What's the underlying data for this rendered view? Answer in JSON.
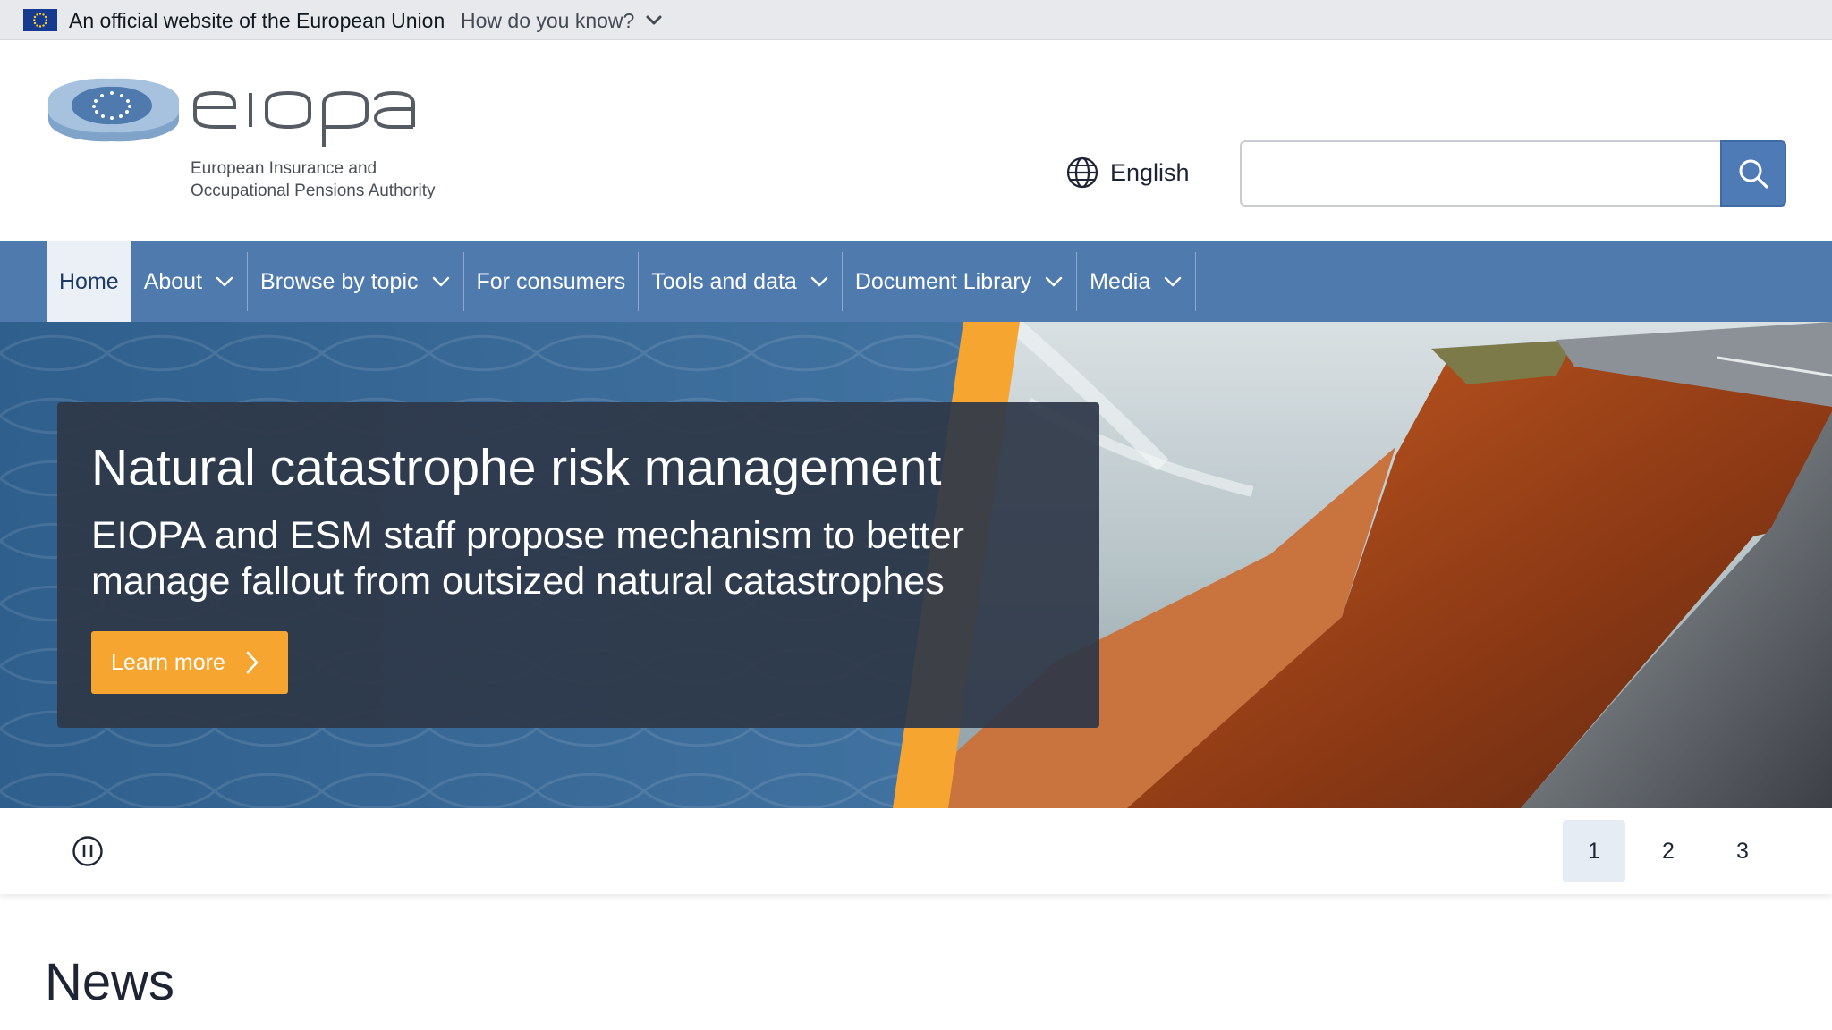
{
  "eu_banner": {
    "text": "An official website of the European Union",
    "how_do_you_know": "How do you know?",
    "flag_icon": "eu-flag-icon"
  },
  "header": {
    "logo_text": "eiopa",
    "logo_subtitle_line1": "European Insurance and",
    "logo_subtitle_line2": "Occupational Pensions Authority",
    "language": "English",
    "search_placeholder": "",
    "search_value": ""
  },
  "nav": {
    "items": [
      {
        "label": "Home",
        "active": true,
        "has_dropdown": false
      },
      {
        "label": "About",
        "active": false,
        "has_dropdown": true
      },
      {
        "label": "Browse by topic",
        "active": false,
        "has_dropdown": true
      },
      {
        "label": "For consumers",
        "active": false,
        "has_dropdown": false
      },
      {
        "label": "Tools and data",
        "active": false,
        "has_dropdown": true
      },
      {
        "label": "Document Library",
        "active": false,
        "has_dropdown": true
      },
      {
        "label": "Media",
        "active": false,
        "has_dropdown": true
      }
    ]
  },
  "hero": {
    "title": "Natural catastrophe risk management",
    "subtitle": "EIOPA and ESM staff propose mechanism to better manage fallout from outsized natural catastrophes",
    "button_label": "Learn more"
  },
  "carousel": {
    "pages": [
      "1",
      "2",
      "3"
    ],
    "active_page": "1"
  },
  "news": {
    "title": "News"
  },
  "colors": {
    "nav_blue": "#4f7aae",
    "accent_orange": "#f6a530",
    "card_dark": "#2e3848"
  }
}
